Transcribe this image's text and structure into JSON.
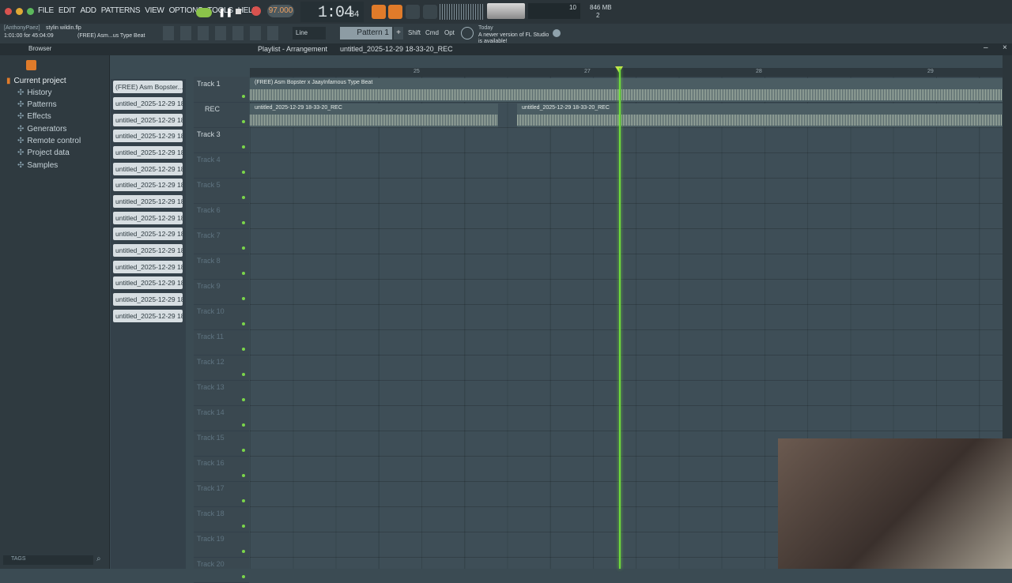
{
  "menu": [
    "FILE",
    "EDIT",
    "ADD",
    "PATTERNS",
    "VIEW",
    "OPTIONS",
    "TOOLS",
    "HELP"
  ],
  "transport": {
    "tempo": "97.000",
    "time": "1:04",
    "time_small": "84",
    "pattern": "Pattern 1",
    "cpu": "10",
    "mem": "846 MB",
    "poly": "2"
  },
  "project": {
    "user": "[AnthonyPaez]",
    "file": "stylin wildin.flp",
    "hint": "1:01:00 for 45:04:09",
    "hint2": "(FREE) Asm...us Type Beat"
  },
  "row2": {
    "snap": "Line",
    "shift": "Shift",
    "cmd": "Cmd",
    "opt": "Opt",
    "news_today": "Today",
    "news_text": "A newer version of FL Studio is available!"
  },
  "playlist": {
    "title": "Playlist - Arrangement",
    "crumb": "untitled_2025-12-29 18-33-20_REC"
  },
  "browser": {
    "title": "Browser",
    "items": [
      "Current project",
      "History",
      "Patterns",
      "Effects",
      "Generators",
      "Remote control",
      "Project data",
      "Samples"
    ],
    "tags": "TAGS"
  },
  "clips": [
    "(FREE) Asm Bopster...",
    "untitled_2025-12-29 18-...",
    "untitled_2025-12-29 18-...",
    "untitled_2025-12-29 18-...",
    "untitled_2025-12-29 18-...",
    "untitled_2025-12-29 18-...",
    "untitled_2025-12-29 18-...",
    "untitled_2025-12-29 18-...",
    "untitled_2025-12-29 18-...",
    "untitled_2025-12-29 18-...",
    "untitled_2025-12-29 18-...",
    "untitled_2025-12-29 18-...",
    "untitled_2025-12-29 18-...",
    "untitled_2025-12-29 18-...",
    "untitled_2025-12-29 18-..."
  ],
  "tracks": [
    "Track 1",
    "REC",
    "Track 3",
    "Track 4",
    "Track 5",
    "Track 6",
    "Track 7",
    "Track 8",
    "Track 9",
    "Track 10",
    "Track 11",
    "Track 12",
    "Track 13",
    "Track 14",
    "Track 15",
    "Track 16",
    "Track 17",
    "Track 18",
    "Track 19",
    "Track 20"
  ],
  "ruler": [
    "25",
    "27",
    "28",
    "29"
  ],
  "audio": {
    "lane1": "(FREE) Asm Bopster x JaayInfamous Type Beat",
    "lane2a": "untitled_2025-12-29 18-33-20_REC",
    "lane2b": "untitled_2025-12-29 18-33-20_REC"
  }
}
